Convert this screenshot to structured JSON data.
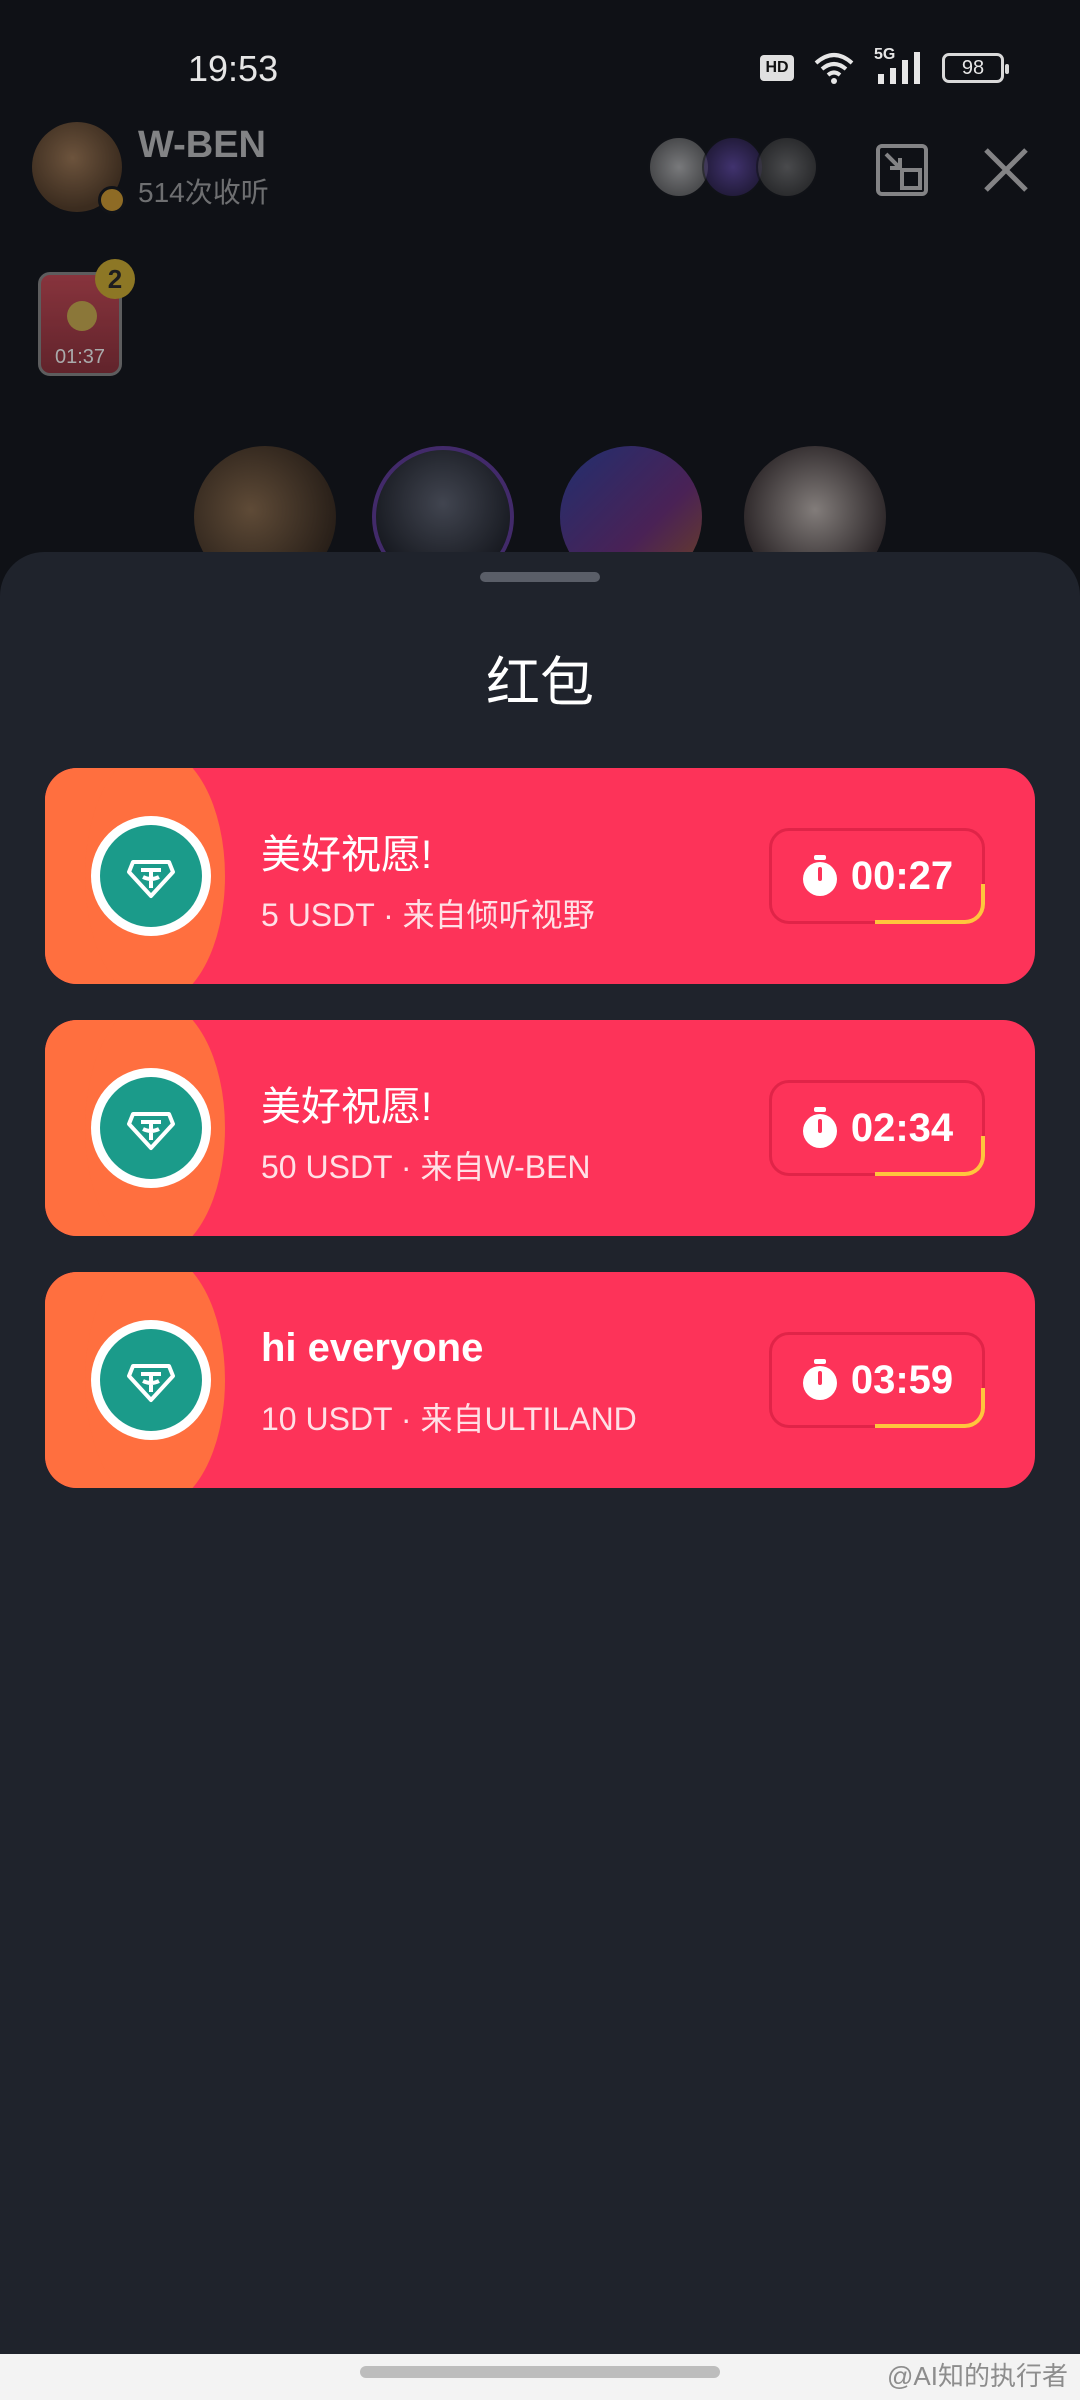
{
  "status_bar": {
    "time": "19:53",
    "hd": "HD",
    "network": "5G",
    "battery": "98"
  },
  "room": {
    "host_name": "W-BEN",
    "listeners": "514次收听",
    "mini_packet_timer": "01:37",
    "mini_packet_count": "2"
  },
  "sheet": {
    "title": "红包",
    "packets": [
      {
        "title": "美好祝愿!",
        "subtitle": "5 USDT · 来自倾听视野",
        "timer": "00:27"
      },
      {
        "title": "美好祝愿!",
        "subtitle": "50 USDT · 来自W-BEN",
        "timer": "02:34"
      },
      {
        "title": "hi everyone",
        "subtitle": "10 USDT · 来自ULTILAND",
        "timer": "03:59"
      }
    ]
  },
  "watermark": "@AI知的执行者",
  "colors": {
    "sheet_bg": "#1f232c",
    "packet_red": "#fd3359",
    "packet_orange": "#ff6f3f",
    "usdt_green": "#1b9b8a",
    "timer_accent": "#ffc53d"
  },
  "icons": [
    "usdt-coin-icon",
    "stopwatch-icon",
    "minimize-icon",
    "close-icon",
    "wifi-icon",
    "signal-icon"
  ]
}
